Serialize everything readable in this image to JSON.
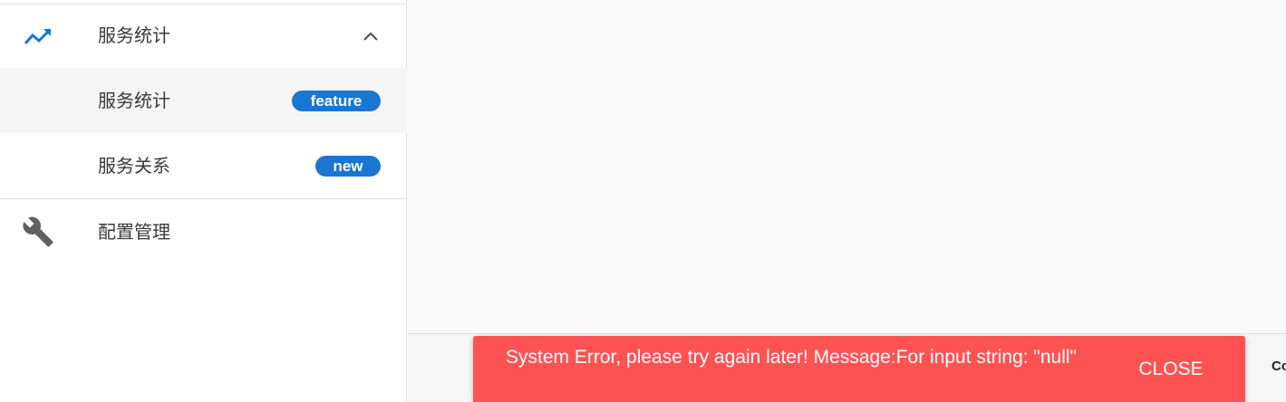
{
  "sidebar": {
    "group": {
      "label": "服务统计",
      "icon": "trending-up-icon",
      "expanded": true
    },
    "items": [
      {
        "label": "服务统计",
        "badge": "feature",
        "selected": true
      },
      {
        "label": "服务关系",
        "badge": "new",
        "selected": false
      }
    ],
    "config": {
      "label": "配置管理",
      "icon": "wrench-icon"
    }
  },
  "footer": {
    "partial_text": "Co"
  },
  "snackbar": {
    "message": "System Error, please try again later! Message:For input string: \"null\"",
    "close_label": "CLOSE",
    "color": "#ff5252"
  },
  "colors": {
    "accent": "#1976d2",
    "error": "#ff5252"
  }
}
